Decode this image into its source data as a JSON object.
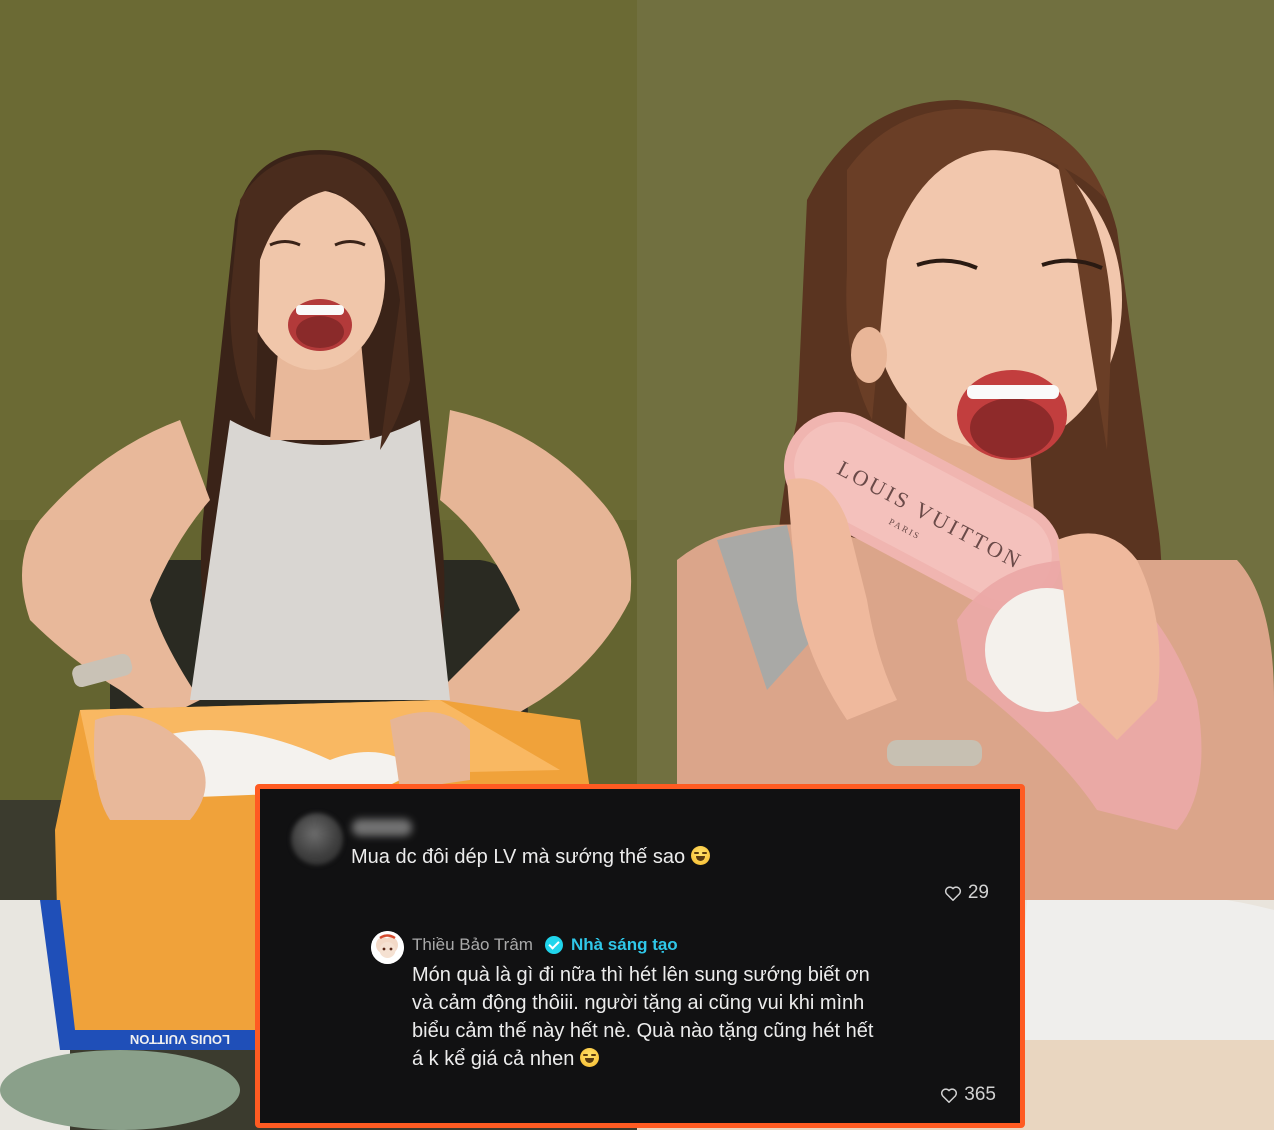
{
  "photo_left": {
    "box_brand_text": "LOUIS VUITTON"
  },
  "photo_right": {
    "sandal_brand_text": "LOUIS VUITTON",
    "sandal_brand_sub": "PARIS"
  },
  "comment": {
    "text": "Mua dc đôi dép LV mà sướng thế sao",
    "emoji": "face-with-tears-of-joy-icon",
    "likes": "29"
  },
  "reply": {
    "author": "Thiều Bảo Trâm",
    "badge": "Nhà sáng tạo",
    "lines": [
      "Món quà là gì đi nữa thì hét lên sung sướng biết ơn",
      "và cảm động thôiii. người tặng ai cũng vui khi mình",
      "biểu cảm thế này hết nè. Quà nào tặng cũng hét hết",
      "á k kể giá cả nhen"
    ],
    "emoji": "grinning-face-icon",
    "likes": "365"
  },
  "colors": {
    "card_border": "#ff5b22",
    "card_bg": "#111112",
    "creator_badge": "#2fc7e8"
  }
}
